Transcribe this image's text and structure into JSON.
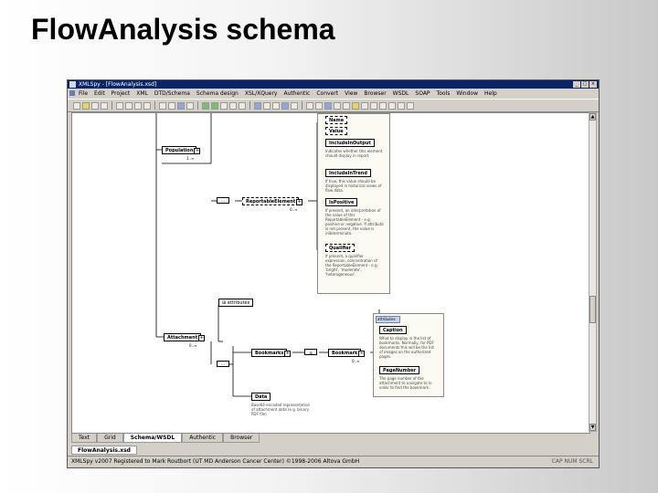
{
  "slide": {
    "title": "FlowAnalysis schema"
  },
  "window": {
    "title": "XMLSpy - [FlowAnalysis.xsd]",
    "menu": [
      "File",
      "Edit",
      "Project",
      "XML",
      "DTD/Schema",
      "Schema design",
      "XSL/XQuery",
      "Authentic",
      "Convert",
      "View",
      "Browser",
      "WSDL",
      "SOAP",
      "Tools",
      "Window",
      "Help"
    ]
  },
  "diagram": {
    "nodes": {
      "population": "Population",
      "population_card": "1..∞",
      "reportable_element": "ReportableElement",
      "reportable_card": "0..∞",
      "attributes": "attributes",
      "attachment": "Attachment",
      "attachment_card": "0..∞",
      "bookmarks": "Bookmarks",
      "bookmark": "Bookmark",
      "bookmark_card": "0..∞",
      "data": "Data"
    },
    "card1": {
      "items": [
        {
          "name": "Name",
          "desc": ""
        },
        {
          "name": "Value",
          "desc": ""
        },
        {
          "name": "IncludeInOutput",
          "desc": "Indicates whether this element should display in report."
        },
        {
          "name": "IncludeInTrend",
          "desc": "If true, this value should be displayed in historical views of flow data."
        },
        {
          "name": "IsPositive",
          "desc": "If present, an interpretation of the value of this ReportableElement - e.g. positive or negative. If attribute is not present, the value is indeterminate."
        },
        {
          "name": "Qualifier",
          "desc": "If present, a qualifier expression, concentration of the ReportableElement - e.g. 'bright', 'moderate', 'heterogeneous'."
        }
      ]
    },
    "card2": {
      "header": "attributes",
      "items": [
        {
          "name": "Caption",
          "desc": "What to display in the list of bookmarks. Normally, for PDF documents this will be the list of images on the authorized pages."
        },
        {
          "name": "PageNumber",
          "desc": "The page number of the attachment to navigate to in order to find the bookmark."
        }
      ]
    },
    "data_desc": "Base64-encoded representation of attachment data (e.g. binary PDF file)."
  },
  "view_tabs": [
    "Text",
    "Grid",
    "Schema/WSDL",
    "Authentic",
    "Browser"
  ],
  "active_view": "Schema/WSDL",
  "doc_tab": "FlowAnalysis.xsd",
  "status": {
    "left": "XMLSpy v2007   Registered to Mark Routbort (UT MD Anderson Cancer Center)   ©1998-2006 Altova GmbH",
    "right": "CAP  NUM  SCRL"
  }
}
